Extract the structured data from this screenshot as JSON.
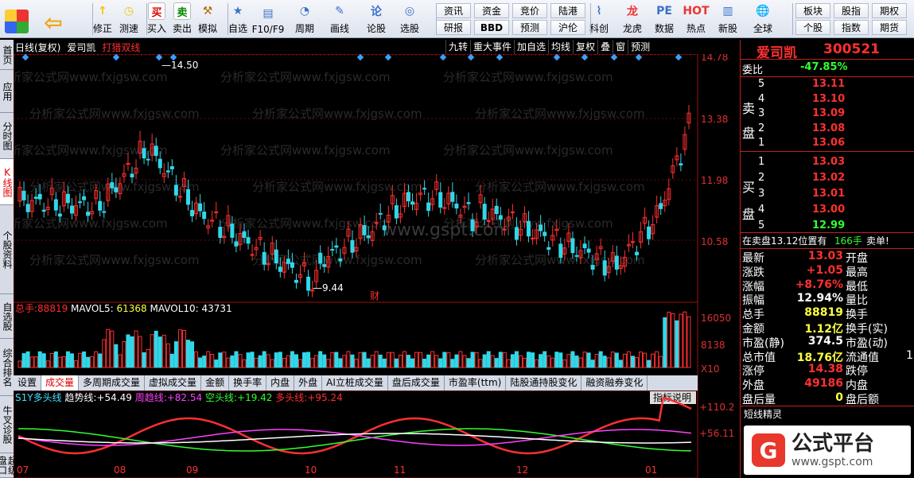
{
  "toolbar": {
    "buttons": [
      {
        "label": "修正",
        "icon": "arrow-up-icon"
      },
      {
        "label": "测速",
        "icon": "clock-icon"
      },
      {
        "label": "买入",
        "icon": "buy-icon"
      },
      {
        "label": "卖出",
        "icon": "sell-icon"
      },
      {
        "label": "模拟",
        "icon": "hammer-icon"
      },
      {
        "label": "自选",
        "icon": "star-icon"
      },
      {
        "label": "F10/F9",
        "icon": "f10-icon"
      },
      {
        "label": "周期",
        "icon": "cycle-icon"
      },
      {
        "label": "画线",
        "icon": "pencil-icon"
      },
      {
        "label": "论股",
        "icon": "forum-icon"
      },
      {
        "label": "选股",
        "icon": "select-stock-icon"
      },
      {
        "label": "科创",
        "icon": "kechuang-icon"
      },
      {
        "label": "龙虎",
        "icon": "dragon-tiger-icon"
      },
      {
        "label": "数据",
        "icon": "data-icon"
      },
      {
        "label": "热点",
        "icon": "hotspot-icon"
      },
      {
        "label": "新股",
        "icon": "new-stock-icon"
      },
      {
        "label": "全球",
        "icon": "globe-icon"
      }
    ],
    "grid1": [
      "资讯",
      "资金",
      "竞价",
      "陆港",
      "研报",
      "BBD",
      "预测",
      "沪伦"
    ],
    "grid2": [
      "板块",
      "股指",
      "期权",
      "个股",
      "指数",
      "期货"
    ]
  },
  "sidetabs": [
    "首页",
    "应用",
    "分时图",
    "K线图",
    "个股资料",
    "自选股",
    "综合排名",
    "牛叉诊股",
    "超级盘口"
  ],
  "chart": {
    "mode": "日线(复权)",
    "stock_name": "爱司凯",
    "indicator": "打猎双线",
    "buttons": [
      "九转",
      "重大事件",
      "加自选",
      "均线",
      "复权",
      "叠",
      "窗",
      "预测"
    ],
    "price_ticks": [
      "14.78",
      "13.38",
      "11.98",
      "10.58"
    ],
    "high_label": "14.50",
    "low_label": "9.44",
    "cai_label": "财",
    "watermark": "www.gspt.com",
    "watermark2": "分析家公式网www.fxjgsw.com",
    "volume_line": {
      "total_label": "总手:",
      "total": "88819",
      "ma5_label": "MAVOL5:",
      "ma5": "61368",
      "ma10_label": "MAVOL10:",
      "ma10": "43731"
    },
    "volume_ticks": [
      "16050",
      "8138",
      "X10"
    ],
    "indicator_tabs": [
      "设置",
      "成交量",
      "多周期成交量",
      "虚拟成交量",
      "金额",
      "换手率",
      "内盘",
      "外盘",
      "AI立桩成交量",
      "盘后成交量",
      "市盈率(ttm)",
      "陆股通持股变化",
      "融资融券变化"
    ],
    "s1y": {
      "name": "S1Y多头线",
      "trend_label": "趋势线:",
      "trend": "+54.49",
      "week_label": "周趋线:",
      "week": "+82.54",
      "short_label": "空头线:",
      "short": "+19.42",
      "long_label": "多头线:",
      "long": "+95.24"
    },
    "s1y_ticks": [
      "110.2",
      "56.11"
    ],
    "indicator_help": "指标说明",
    "months": [
      "07",
      "08",
      "09",
      "10",
      "11",
      "12",
      "01"
    ]
  },
  "right_panel": {
    "name": "爱司凯",
    "code": "300521",
    "weibi_label": "委比",
    "weibi": "-47.85%",
    "sell_label": "卖盘",
    "buy_label": "买盘",
    "asks": [
      {
        "lvl": "5",
        "price": "13.11"
      },
      {
        "lvl": "4",
        "price": "13.10"
      },
      {
        "lvl": "3",
        "price": "13.09"
      },
      {
        "lvl": "2",
        "price": "13.08"
      },
      {
        "lvl": "1",
        "price": "13.06"
      }
    ],
    "bids": [
      {
        "lvl": "1",
        "price": "13.03"
      },
      {
        "lvl": "2",
        "price": "13.02"
      },
      {
        "lvl": "3",
        "price": "13.01"
      },
      {
        "lvl": "4",
        "price": "13.00"
      },
      {
        "lvl": "5",
        "price": "12.99"
      }
    ],
    "trade_line": {
      "text": "在卖盘13.12位置有",
      "vol": "166手",
      "tag": "卖单!"
    },
    "stats": [
      {
        "l1": "最新",
        "v1": "13.03",
        "c1": "red",
        "l2": "开盘",
        "v2": ""
      },
      {
        "l1": "涨跌",
        "v1": "+1.05",
        "c1": "red",
        "l2": "最高",
        "v2": ""
      },
      {
        "l1": "涨幅",
        "v1": "+8.76%",
        "c1": "red",
        "l2": "最低",
        "v2": ""
      },
      {
        "l1": "振幅",
        "v1": "12.94%",
        "c1": "white",
        "l2": "量比",
        "v2": ""
      },
      {
        "l1": "总手",
        "v1": "88819",
        "c1": "yellow",
        "l2": "换手",
        "v2": ""
      },
      {
        "l1": "金额",
        "v1": "1.12亿",
        "c1": "yellow",
        "l2": "换手(实)",
        "v2": ""
      },
      {
        "l1": "市盈(静)",
        "v1": "374.5",
        "c1": "white",
        "l2": "市盈(动)",
        "v2": ""
      },
      {
        "l1": "总市值",
        "v1": "18.76亿",
        "c1": "yellow",
        "l2": "流通值",
        "v2": "1"
      },
      {
        "l1": "涨停",
        "v1": "14.38",
        "c1": "red",
        "l2": "跌停",
        "v2": ""
      },
      {
        "l1": "外盘",
        "v1": "49186",
        "c1": "red",
        "l2": "内盘",
        "v2": ""
      },
      {
        "l1": "盘后量",
        "v1": "0",
        "c1": "yellow",
        "l2": "盘后额",
        "v2": ""
      }
    ],
    "short_wizard": "短线精灵",
    "logo_text": "公式平台",
    "logo_url": "www.gspt.com"
  }
}
